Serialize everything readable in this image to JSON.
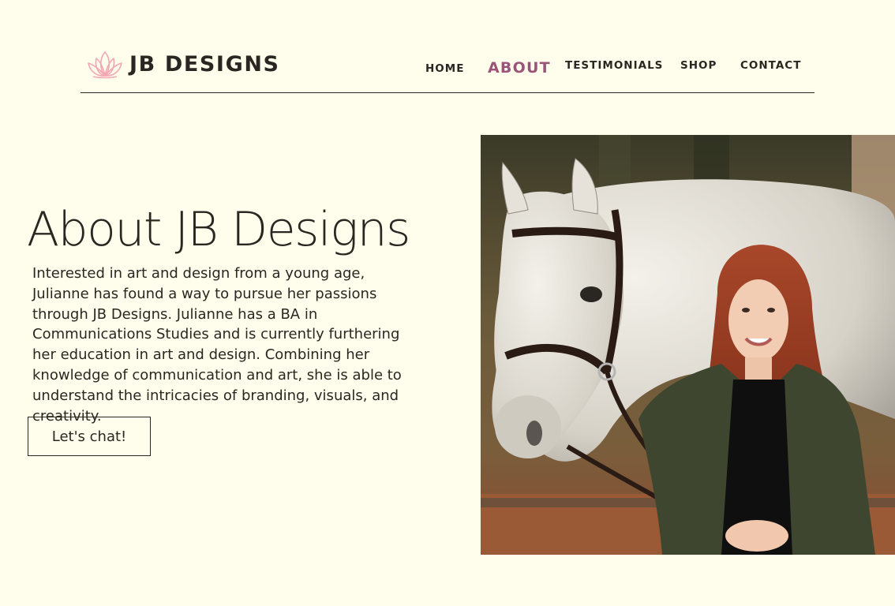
{
  "brand": {
    "logo_icon": "lotus-icon",
    "name": "JB DESIGNS",
    "accent_color": "#9c5379",
    "logo_color": "#f2a7b3",
    "background_color": "#fffdeb"
  },
  "nav": {
    "items": [
      {
        "label": "HOME",
        "active": false
      },
      {
        "label": "ABOUT",
        "active": true
      },
      {
        "label": "TESTIMONIALS",
        "active": false
      },
      {
        "label": "SHOP",
        "active": false
      },
      {
        "label": "CONTACT",
        "active": false
      }
    ]
  },
  "main": {
    "title": "About JB Designs",
    "body": "Interested in art and design from a young age, Julianne has found a way to pursue her passions through JB Designs. Julianne has a BA in Communications Studies and is currently furthering her education in art and design. Combining her knowledge of communication and art, she is able to understand the intricacies of branding, visuals, and creativity.",
    "cta_label": "Let's chat!",
    "photo": "photo-woman-with-grey-horse"
  }
}
